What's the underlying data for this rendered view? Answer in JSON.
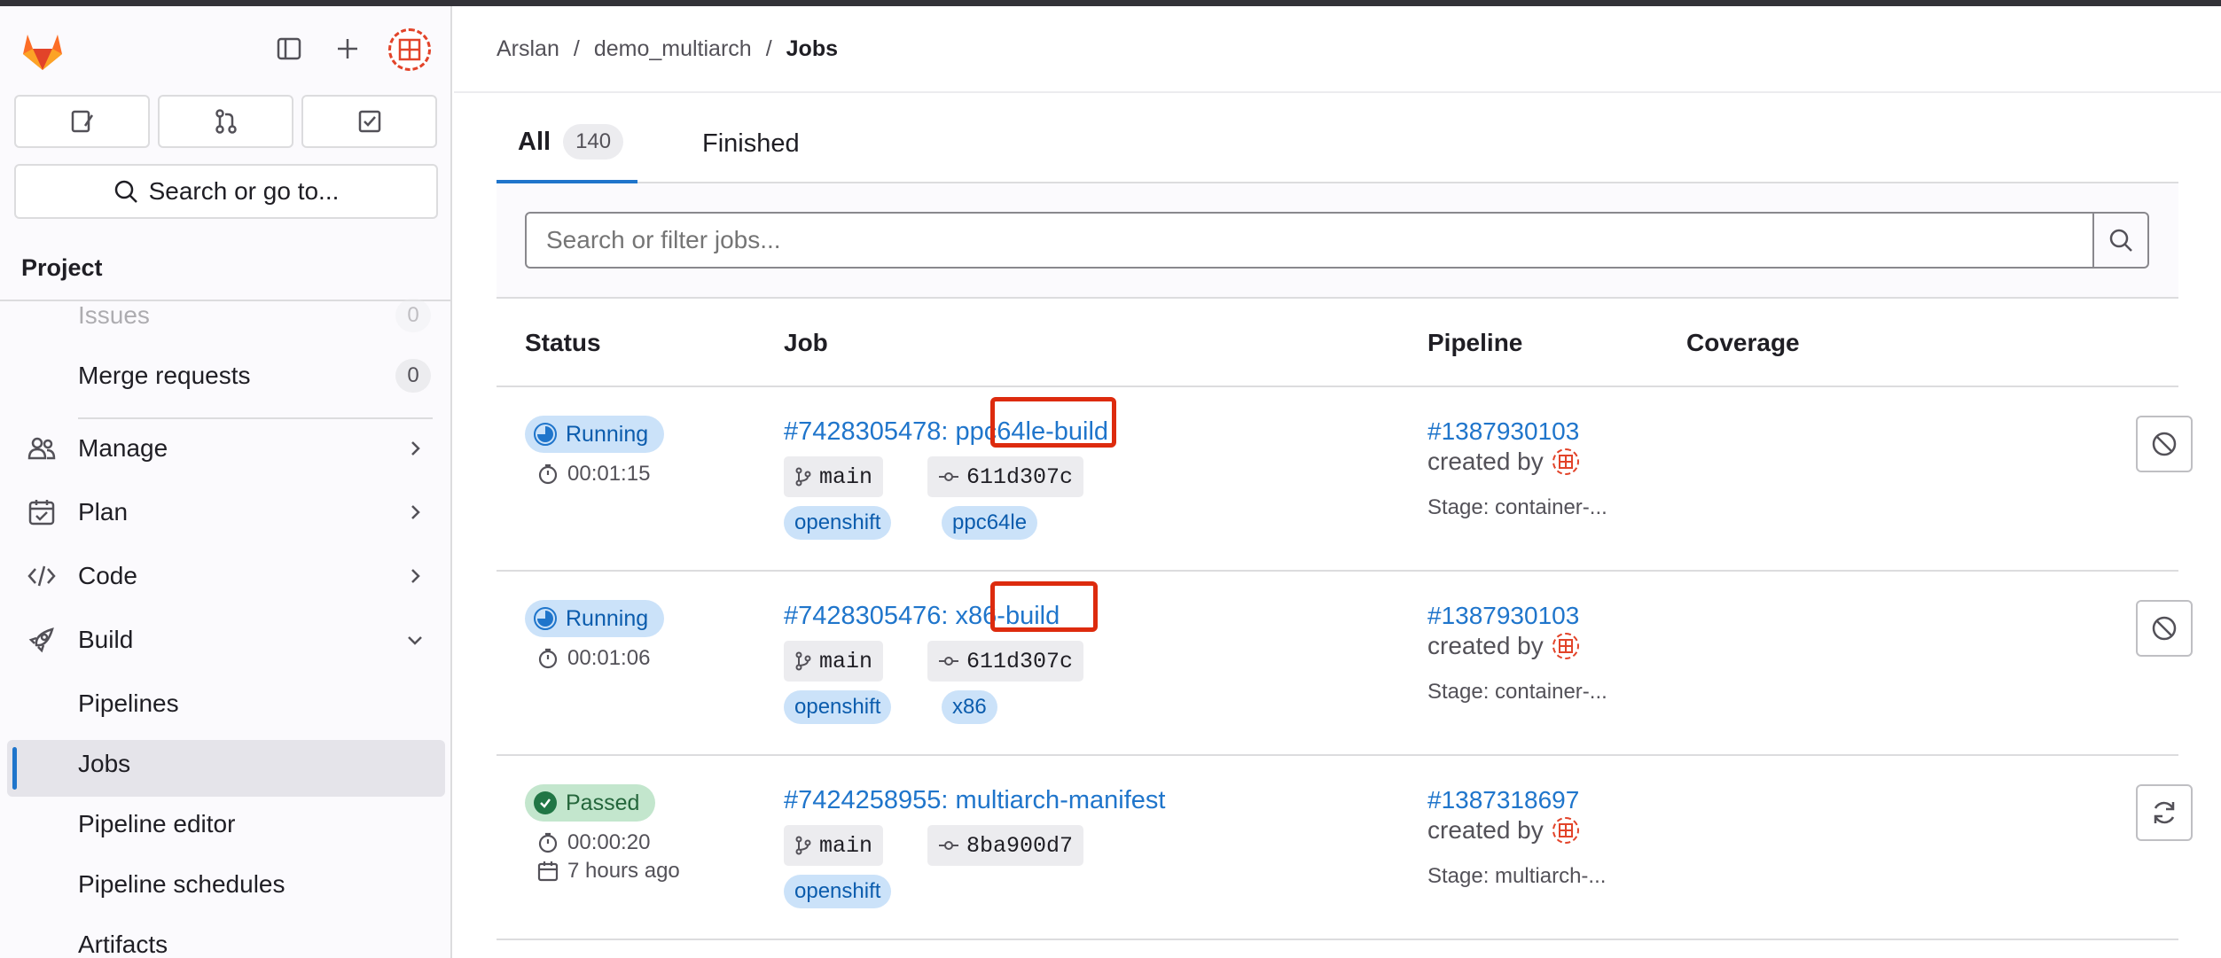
{
  "breadcrumb": {
    "group": "Arslan",
    "project": "demo_multiarch",
    "current": "Jobs"
  },
  "sidebar": {
    "search_label": "Search or go to...",
    "section_title": "Project",
    "issues": {
      "label": "Issues",
      "count": "0"
    },
    "merge_requests": {
      "label": "Merge requests",
      "count": "0"
    },
    "manage": "Manage",
    "plan": "Plan",
    "code": "Code",
    "build": "Build",
    "pipelines": "Pipelines",
    "jobs": "Jobs",
    "pipeline_editor": "Pipeline editor",
    "pipeline_schedules": "Pipeline schedules",
    "artifacts": "Artifacts"
  },
  "tabs": {
    "all_label": "All",
    "all_count": "140",
    "finished_label": "Finished"
  },
  "filter": {
    "placeholder": "Search or filter jobs..."
  },
  "table": {
    "headers": {
      "status": "Status",
      "job": "Job",
      "pipeline": "Pipeline",
      "coverage": "Coverage"
    },
    "rows": [
      {
        "status": "Running",
        "duration": "00:01:15",
        "job_id": "#7428305478",
        "job_sep": ": ",
        "job_name": "ppc64le-build",
        "branch": "main",
        "commit": "611d307c",
        "tags": [
          "openshift",
          "ppc64le"
        ],
        "pipeline": "#1387930103",
        "created_by": "created by",
        "stage": "Stage: container-..."
      },
      {
        "status": "Running",
        "duration": "00:01:06",
        "job_id": "#7428305476",
        "job_sep": ": ",
        "job_name": "x86-build",
        "branch": "main",
        "commit": "611d307c",
        "tags": [
          "openshift",
          "x86"
        ],
        "pipeline": "#1387930103",
        "created_by": "created by",
        "stage": "Stage: container-..."
      },
      {
        "status": "Passed",
        "duration": "00:00:20",
        "finished": "7 hours ago",
        "job_id": "#7424258955",
        "job_sep": ": ",
        "job_name": "multiarch-manifest",
        "branch": "main",
        "commit": "8ba900d7",
        "tags": [
          "openshift"
        ],
        "pipeline": "#1387318697",
        "created_by": "created by",
        "stage": "Stage: multiarch-..."
      }
    ]
  },
  "colors": {
    "link": "#1f75cb",
    "highlight": "#dd2b0e",
    "running_bg": "#cbe2f9",
    "passed_bg": "#c3e6cd"
  }
}
